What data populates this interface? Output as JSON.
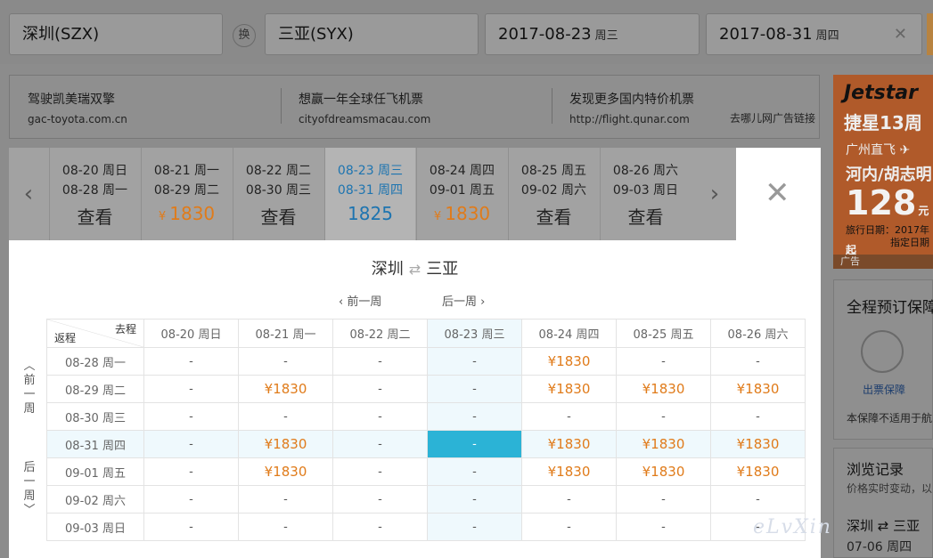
{
  "search": {
    "from": "深圳(SZX)",
    "swap": "换",
    "to": "三亚(SYX)",
    "depart_date": "2017-08-23",
    "depart_weekday": "周三",
    "return_date": "2017-08-31",
    "return_weekday": "周四"
  },
  "ads": [
    {
      "title": "驾驶凯美瑞双擎",
      "url": "gac-toyota.com.cn"
    },
    {
      "title": "想赢一年全球任飞机票",
      "url": "cityofdreamsmacau.com"
    },
    {
      "title": "发现更多国内特价机票",
      "url": "http://flight.qunar.com"
    }
  ],
  "ad_note": "去哪儿网广告链接",
  "banner": {
    "brand": "Jetstar",
    "line1": "捷星13周",
    "line2": "广州直飞",
    "line3": "河内/胡志明",
    "price": "128",
    "price_unit": "元起",
    "line4": "旅行日期：2017年",
    "line5": "指定日期",
    "footer": "广告"
  },
  "side_box": {
    "title": "全程预订保障",
    "label": "出票保障",
    "note": "本保障不适用于航"
  },
  "history": {
    "title": "浏览记录",
    "subtitle": "价格实时变动，以",
    "route": "深圳 ⇄ 三亚",
    "date": "07-06 周四"
  },
  "week_strip": [
    {
      "depart": "08-20 周日",
      "return": "08-28 周一",
      "price": "查看",
      "orange": false,
      "active": false
    },
    {
      "depart": "08-21 周一",
      "return": "08-29 周二",
      "price": "1830",
      "orange": true,
      "active": false
    },
    {
      "depart": "08-22 周二",
      "return": "08-30 周三",
      "price": "查看",
      "orange": false,
      "active": false
    },
    {
      "depart": "08-23 周三",
      "return": "08-31 周四",
      "price": "1825",
      "orange": false,
      "active": true
    },
    {
      "depart": "08-24 周四",
      "return": "09-01 周五",
      "price": "1830",
      "orange": true,
      "active": false
    },
    {
      "depart": "08-25 周五",
      "return": "09-02 周六",
      "price": "查看",
      "orange": false,
      "active": false
    },
    {
      "depart": "08-26 周六",
      "return": "09-03 周日",
      "price": "查看",
      "orange": false,
      "active": false
    }
  ],
  "popup": {
    "from": "深圳",
    "to": "三亚",
    "prev_week": "前一周",
    "next_week": "后一周",
    "corner_go": "去程",
    "corner_return": "返程",
    "side_prev": [
      "前",
      "一",
      "周"
    ],
    "side_next": [
      "后",
      "一",
      "周"
    ],
    "columns": [
      "08-20 周日",
      "08-21 周一",
      "08-22 周二",
      "08-23 周三",
      "08-24 周四",
      "08-25 周五",
      "08-26 周六"
    ],
    "rows": [
      {
        "label": "08-28 周一",
        "cells": [
          "-",
          "-",
          "-",
          "-",
          "¥1830",
          "-",
          "-"
        ]
      },
      {
        "label": "08-29 周二",
        "cells": [
          "-",
          "¥1830",
          "-",
          "-",
          "¥1830",
          "¥1830",
          "¥1830"
        ]
      },
      {
        "label": "08-30 周三",
        "cells": [
          "-",
          "-",
          "-",
          "-",
          "-",
          "-",
          "-"
        ]
      },
      {
        "label": "08-31 周四",
        "cells": [
          "-",
          "¥1830",
          "-",
          "-",
          "¥1830",
          "¥1830",
          "¥1830"
        ]
      },
      {
        "label": "09-01 周五",
        "cells": [
          "-",
          "¥1830",
          "-",
          "-",
          "¥1830",
          "¥1830",
          "¥1830"
        ]
      },
      {
        "label": "09-02 周六",
        "cells": [
          "-",
          "-",
          "-",
          "-",
          "-",
          "-",
          "-"
        ]
      },
      {
        "label": "09-03 周日",
        "cells": [
          "-",
          "-",
          "-",
          "-",
          "-",
          "-",
          "-"
        ]
      }
    ],
    "highlight_col": 3,
    "highlight_row": 3
  },
  "watermark": "eLvXin"
}
